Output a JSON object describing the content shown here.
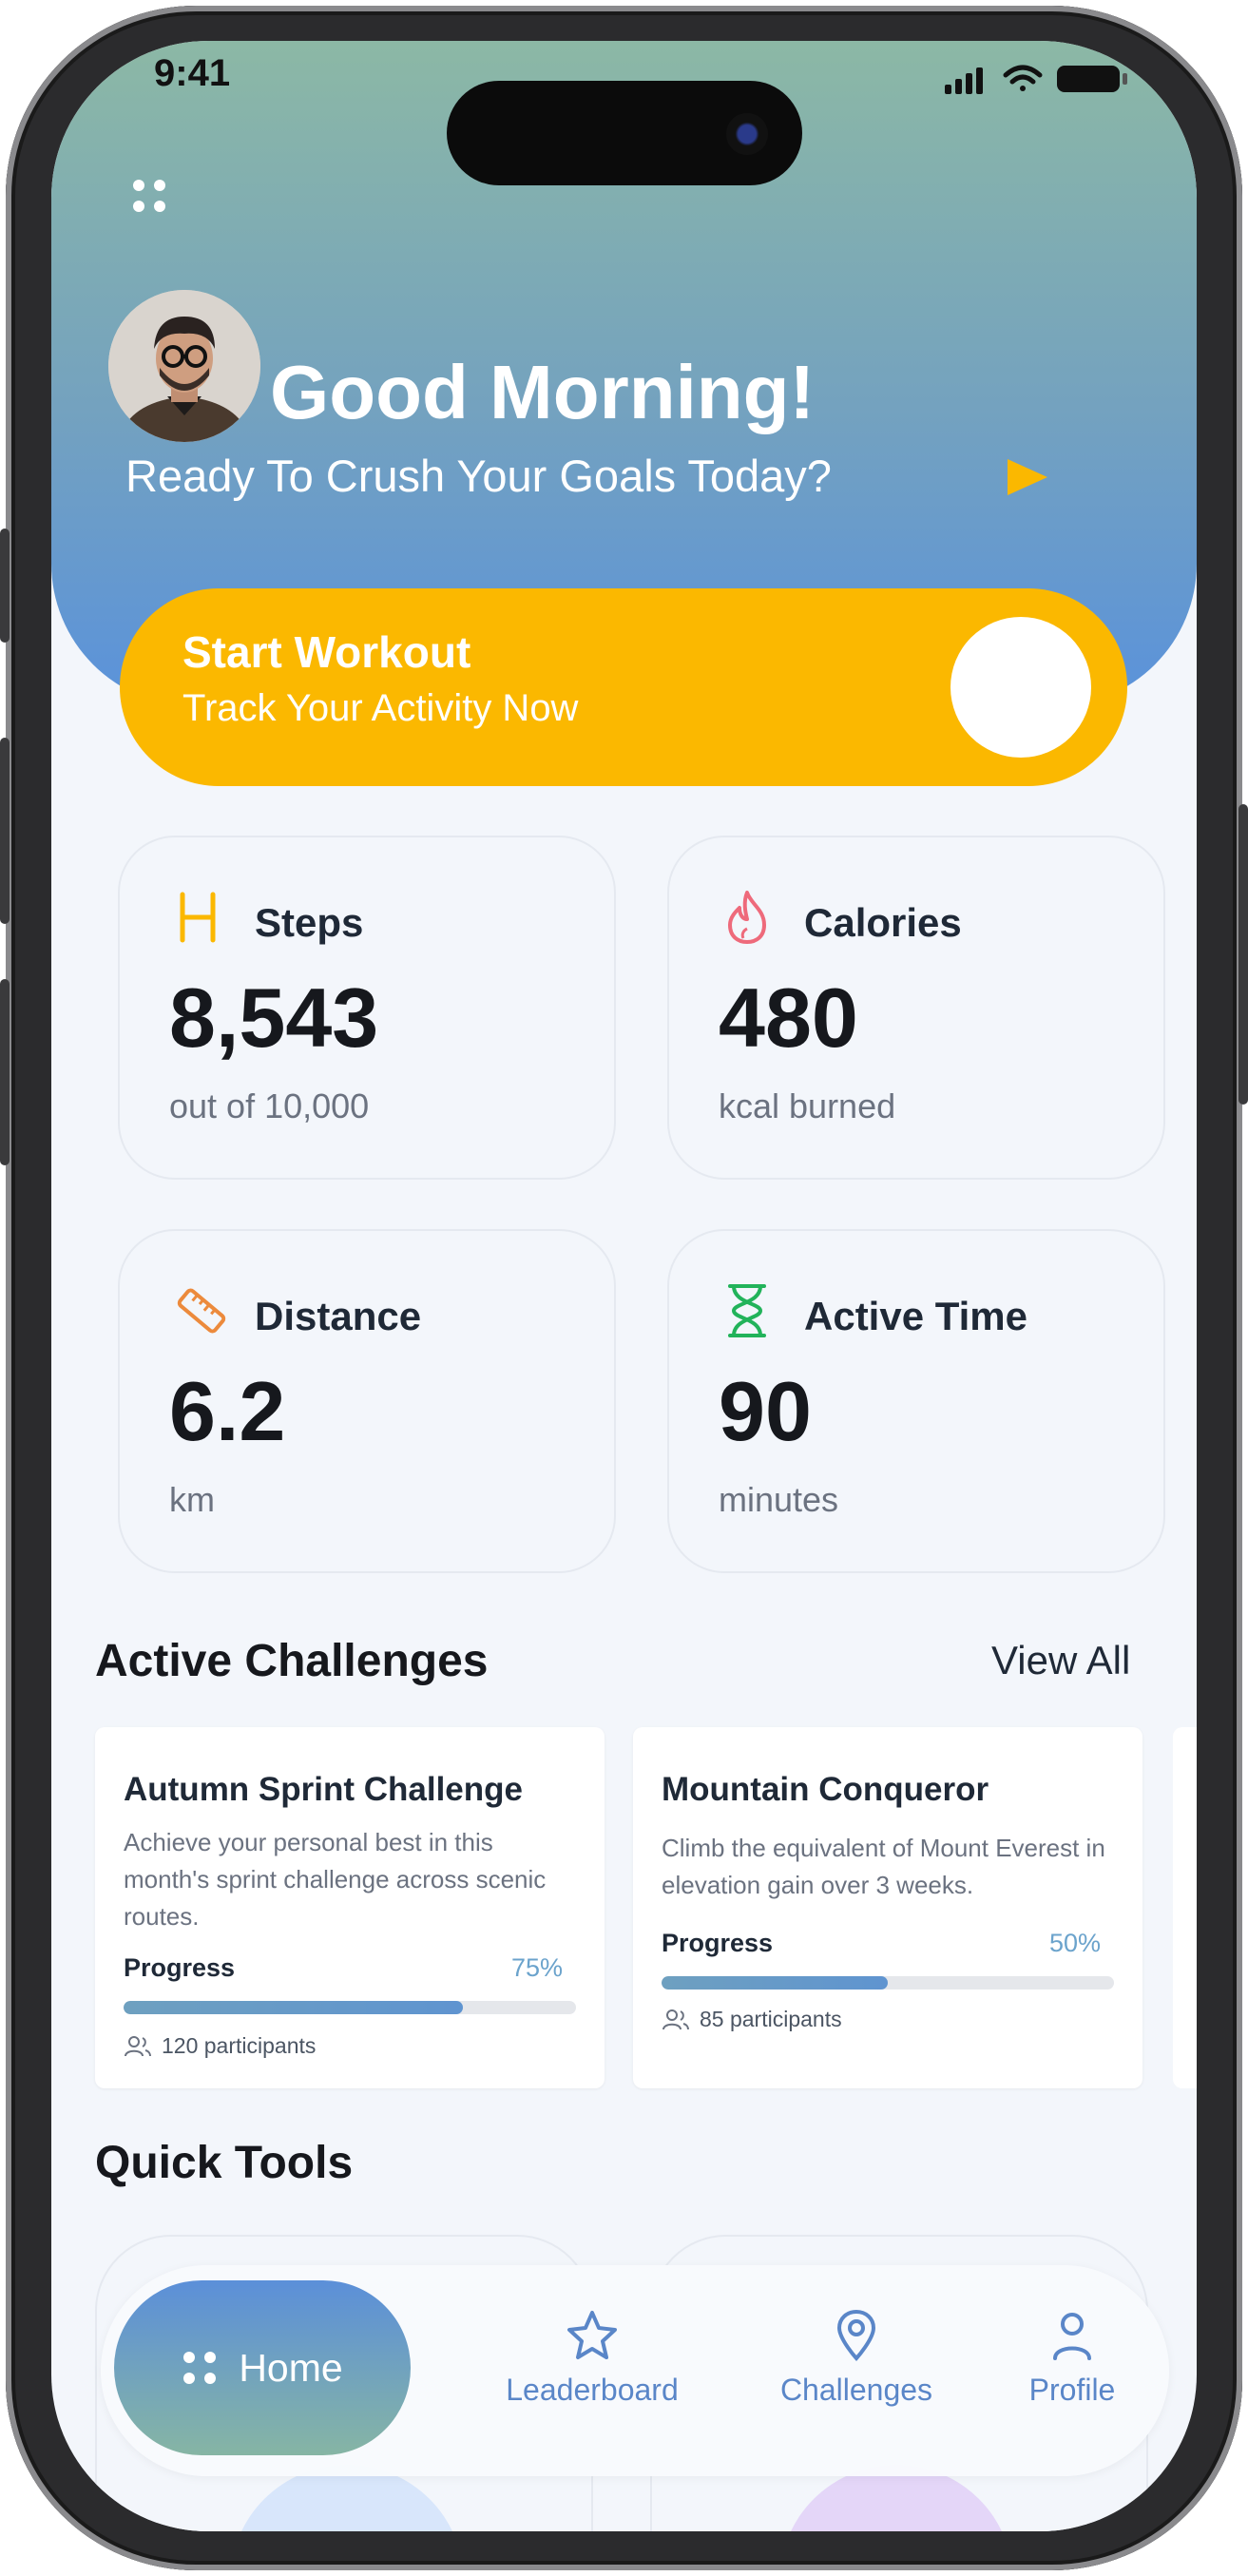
{
  "status_bar": {
    "time": "9:41"
  },
  "header": {
    "greeting": "Good Morning!",
    "subtitle": "Ready To Crush Your Goals Today?"
  },
  "workout": {
    "title": "Start Workout",
    "subtitle": "Track Your Activity Now"
  },
  "stats": [
    {
      "label": "Steps",
      "value": "8,543",
      "unit": "out of 10,000",
      "icon": "steps-icon",
      "color": "#fbb800"
    },
    {
      "label": "Calories",
      "value": "480",
      "unit": "kcal burned",
      "icon": "flame-icon",
      "color": "#ee6a7b"
    },
    {
      "label": "Distance",
      "value": "6.2",
      "unit": "km",
      "icon": "ruler-icon",
      "color": "#ec8a3c"
    },
    {
      "label": "Active Time",
      "value": "90",
      "unit": "minutes",
      "icon": "hourglass-icon",
      "color": "#22b35a"
    }
  ],
  "challenges": {
    "title": "Active Challenges",
    "view_all": "View All",
    "items": [
      {
        "title": "Autumn Sprint Challenge",
        "description": "Achieve your personal best in this month's sprint challenge across scenic routes.",
        "progress_label": "Progress",
        "progress_pct": "75%",
        "progress_value": 0.75,
        "participants": "120 participants"
      },
      {
        "title": "Mountain Conqueror",
        "description": "Climb the equivalent of Mount Everest in elevation gain over 3 weeks.",
        "progress_label": "Progress",
        "progress_pct": "50%",
        "progress_value": 0.5,
        "participants": "85 participants"
      }
    ]
  },
  "quick_tools": {
    "title": "Quick Tools"
  },
  "nav": {
    "home": "Home",
    "leaderboard": "Leaderboard",
    "challenges": "Challenges",
    "profile": "Profile"
  },
  "colors": {
    "accent_yellow": "#fbb800",
    "header_top": "#8cb8a5",
    "header_bottom": "#5a92db",
    "nav_blue": "#5a86c8"
  }
}
